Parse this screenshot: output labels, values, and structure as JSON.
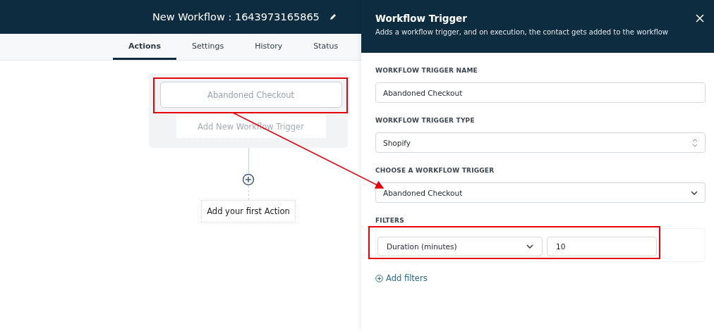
{
  "workflow": {
    "title": "New Workflow : 1643973165865"
  },
  "tabs": [
    {
      "label": "Actions",
      "selected": true
    },
    {
      "label": "Settings",
      "selected": false
    },
    {
      "label": "History",
      "selected": false
    },
    {
      "label": "Status",
      "selected": false
    }
  ],
  "canvas": {
    "trigger": "Abandoned Checkout",
    "add_trigger": "Add New Workflow Trigger",
    "add_action": "Add your first Action"
  },
  "panel": {
    "title": "Workflow Trigger",
    "subtitle": "Adds a workflow trigger, and on execution, the contact gets added to the workflow",
    "fields": [
      {
        "kind": "text",
        "label": "WORKFLOW TRIGGER NAME",
        "value": "Abandoned Checkout"
      },
      {
        "kind": "updown",
        "label": "WORKFLOW TRIGGER TYPE",
        "value": "Shopify"
      },
      {
        "kind": "dropdown",
        "label": "CHOOSE A WORKFLOW TRIGGER",
        "value": "Abandoned Checkout"
      }
    ],
    "filters": {
      "label": "FILTERS",
      "field": "Duration (minutes)",
      "value": "10",
      "add": "Add filters"
    }
  }
}
